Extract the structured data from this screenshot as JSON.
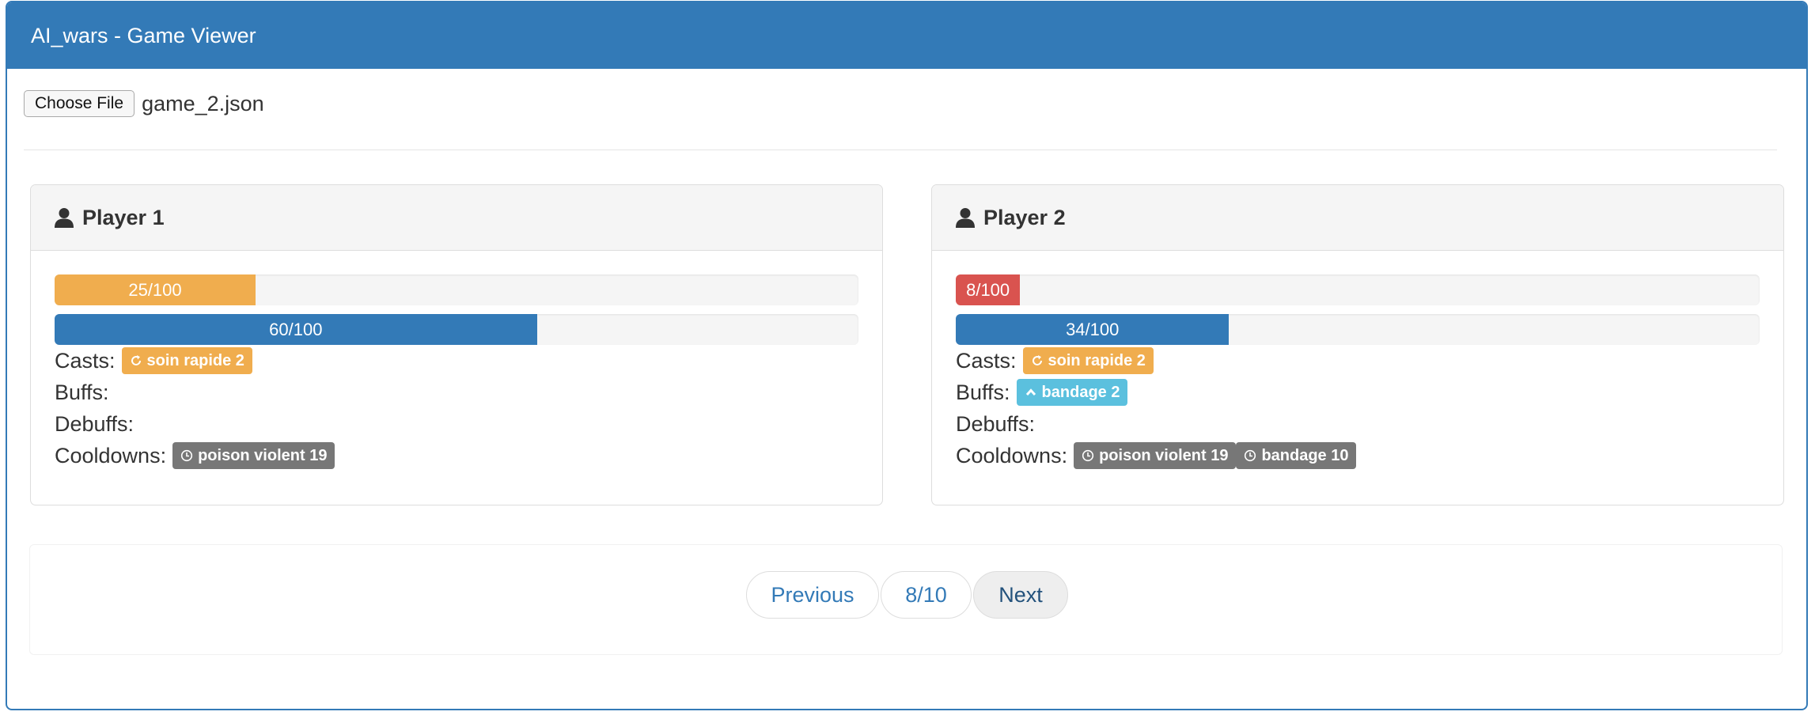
{
  "header": {
    "title": "AI_wars - Game Viewer"
  },
  "file": {
    "button_label": "Choose File",
    "file_name": "game_2.json"
  },
  "labels": {
    "casts": "Casts:",
    "buffs": "Buffs:",
    "debuffs": "Debuffs:",
    "cooldowns": "Cooldowns:"
  },
  "players": [
    {
      "name": "Player 1",
      "hp": {
        "text": "25/100",
        "value": 25,
        "max": 100,
        "color": "#f0ad4e"
      },
      "mana": {
        "text": "60/100",
        "value": 60,
        "max": 100,
        "color": "#337ab7"
      },
      "casts": [
        {
          "label": "soin rapide 2",
          "icon": "refresh-icon",
          "color": "#f0ad4e"
        }
      ],
      "buffs": [],
      "debuffs": [],
      "cooldowns": [
        {
          "label": "poison violent 19",
          "icon": "clock-icon",
          "color": "#777777"
        }
      ]
    },
    {
      "name": "Player 2",
      "hp": {
        "text": "8/100",
        "value": 8,
        "max": 100,
        "color": "#d9534f"
      },
      "mana": {
        "text": "34/100",
        "value": 34,
        "max": 100,
        "color": "#337ab7"
      },
      "casts": [
        {
          "label": "soin rapide 2",
          "icon": "refresh-icon",
          "color": "#f0ad4e"
        }
      ],
      "buffs": [
        {
          "label": "bandage 2",
          "icon": "chevron-up-icon",
          "color": "#5bc0de"
        }
      ],
      "debuffs": [],
      "cooldowns": [
        {
          "label": "poison violent 19",
          "icon": "clock-icon",
          "color": "#777777"
        },
        {
          "label": "bandage 10",
          "icon": "clock-icon",
          "color": "#777777"
        }
      ]
    }
  ],
  "pager": {
    "previous": "Previous",
    "page": "8/10",
    "next": "Next"
  },
  "colors": {
    "primary": "#337ab7",
    "warning": "#f0ad4e",
    "danger": "#d9534f",
    "info": "#5bc0de",
    "default": "#777777"
  }
}
